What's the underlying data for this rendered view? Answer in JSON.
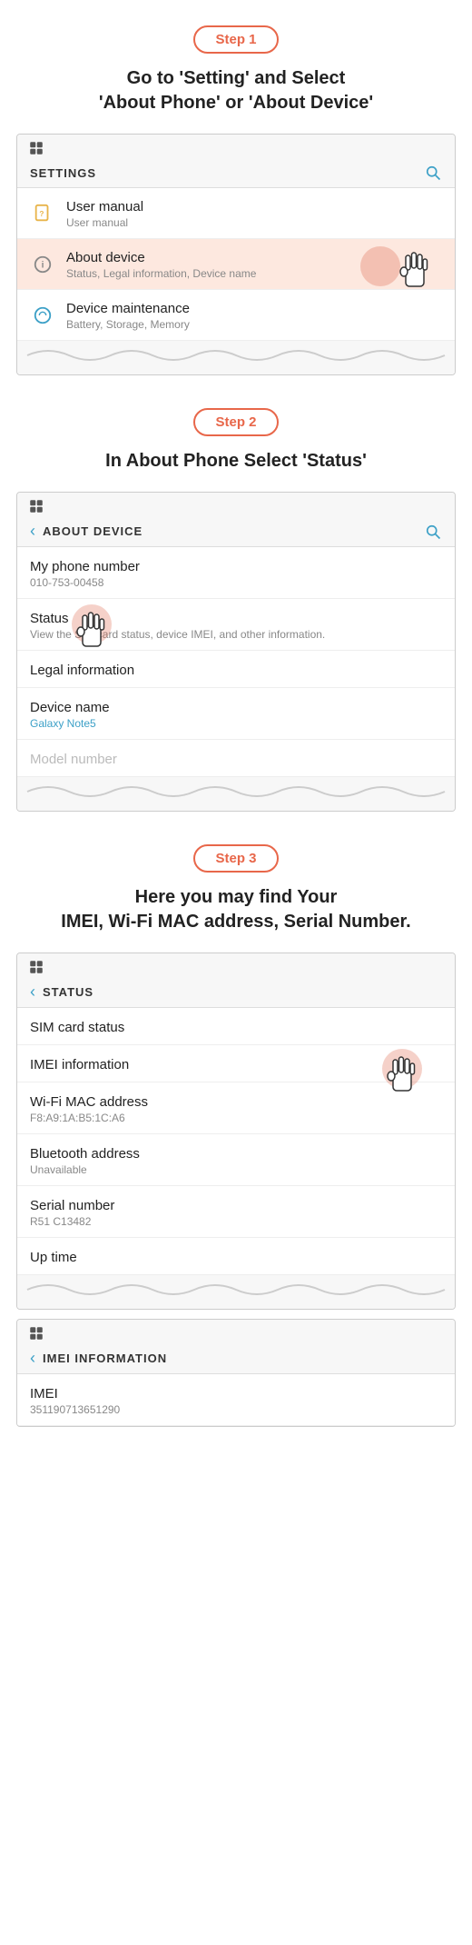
{
  "steps": [
    {
      "badge": "Step 1",
      "title": "Go to 'Setting' and Select\n'About Phone' or 'About Device'",
      "screen_header": "SETTINGS",
      "has_back": false,
      "items": [
        {
          "icon": "manual",
          "title": "User manual",
          "subtitle": "User manual",
          "highlighted": false
        },
        {
          "icon": "info",
          "title": "About device",
          "subtitle": "Status, Legal information, Device name",
          "highlighted": true
        },
        {
          "icon": "wrench",
          "title": "Device maintenance",
          "subtitle": "Battery, Storage, Memory",
          "highlighted": false
        }
      ]
    },
    {
      "badge": "Step 2",
      "title": "In About Phone Select 'Status'",
      "screen_header": "ABOUT DEVICE",
      "has_back": true,
      "items": [
        {
          "type": "status",
          "title": "My phone number",
          "subtitle": "010-753-00458",
          "highlighted": false
        },
        {
          "type": "status",
          "title": "Status",
          "subtitle": "View the SIM card status, device IMEI, and other information.",
          "highlighted": true
        },
        {
          "type": "status",
          "title": "Legal information",
          "subtitle": "",
          "highlighted": false
        },
        {
          "type": "status",
          "title": "Device name",
          "subtitle_blue": "Galaxy Note5",
          "highlighted": false
        },
        {
          "type": "status",
          "title": "Model number",
          "subtitle": "",
          "highlighted": false
        }
      ]
    },
    {
      "badge": "Step 3",
      "title": "Here you may find Your\nIMEI, Wi-Fi MAC address, Serial Number.",
      "screen_header": "STATUS",
      "has_back": true,
      "items": [
        {
          "type": "status",
          "title": "SIM card status",
          "subtitle": "",
          "highlighted": false
        },
        {
          "type": "status",
          "title": "IMEI information",
          "subtitle": "",
          "highlighted": false
        },
        {
          "type": "status",
          "title": "Wi-Fi MAC address",
          "subtitle": "F8:A9:1A:B5:1C:A6",
          "highlighted": true
        },
        {
          "type": "status",
          "title": "Bluetooth address",
          "subtitle": "Unavailable",
          "highlighted": false
        },
        {
          "type": "status",
          "title": "Serial number",
          "subtitle": "R51 C13482",
          "highlighted": true
        },
        {
          "type": "status",
          "title": "Up time",
          "subtitle": "",
          "highlighted": false
        }
      ]
    }
  ],
  "step4": {
    "screen_header": "IMEI INFORMATION",
    "has_back": true,
    "items": [
      {
        "type": "status",
        "title": "IMEI",
        "subtitle": "351190713651290",
        "highlighted": true
      }
    ]
  },
  "icons": {
    "manual": "📄",
    "info": "ℹ",
    "wrench": "🔧",
    "search": "🔍",
    "back": "‹"
  }
}
